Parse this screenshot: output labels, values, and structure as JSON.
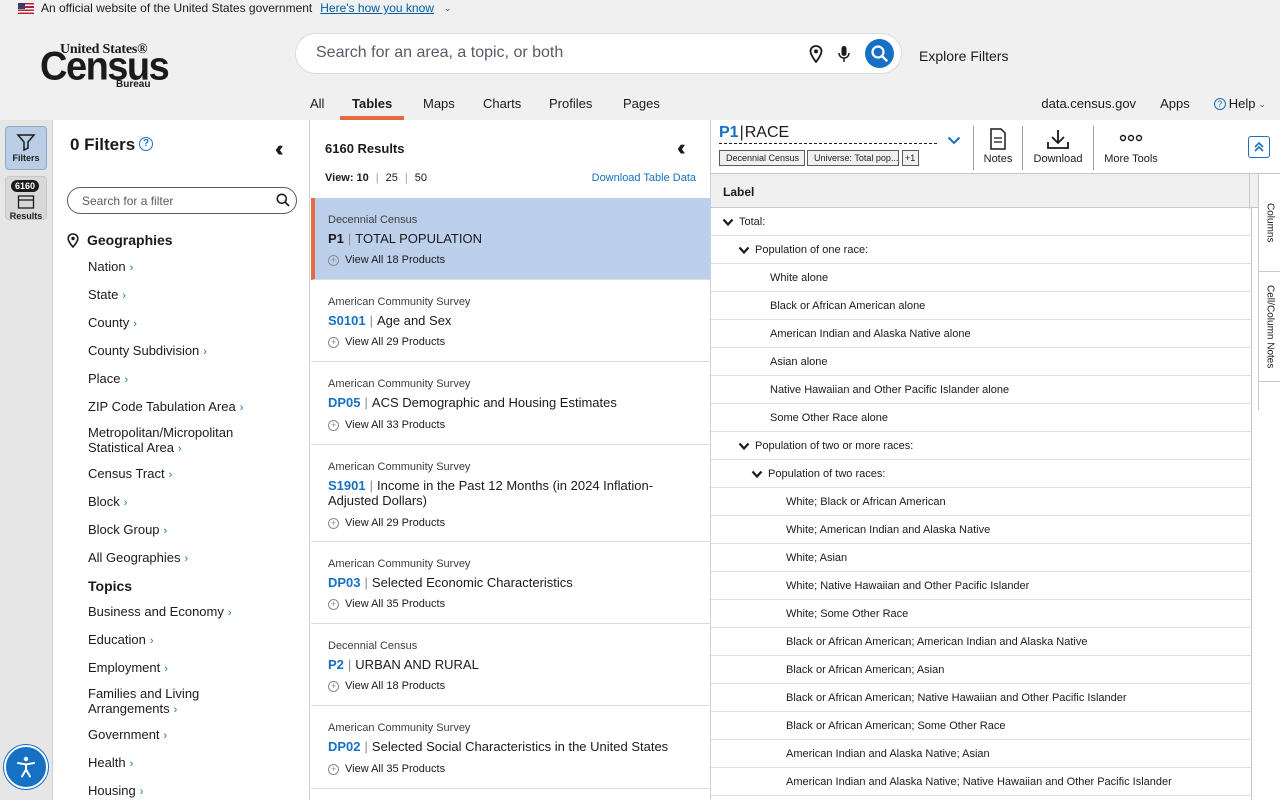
{
  "gov_banner": {
    "text": "An official website of the United States government",
    "link": "Here's how you know"
  },
  "logo": {
    "top": "United States®",
    "main": "Census",
    "bureau": "Bureau"
  },
  "search": {
    "placeholder": "Search for an area, a topic, or both",
    "explore": "Explore Filters"
  },
  "nav": {
    "tabs": [
      "All",
      "Tables",
      "Maps",
      "Charts",
      "Profiles",
      "Pages"
    ],
    "active": "Tables",
    "right": [
      "data.census.gov",
      "Apps",
      "Help"
    ]
  },
  "rail": {
    "filters_label": "Filters",
    "results_label": "Results",
    "results_count": "6160"
  },
  "filters": {
    "title": "0 Filters",
    "search_placeholder": "Search for a filter",
    "geographies_head": "Geographies",
    "geographies": [
      "Nation",
      "State",
      "County",
      "County Subdivision",
      "Place",
      "ZIP Code Tabulation Area",
      [
        "Metropolitan/Micropolitan",
        "Statistical Area"
      ],
      "Census Tract",
      "Block",
      "Block Group",
      "All Geographies"
    ],
    "topics_head": "Topics",
    "topics": [
      "Business and Economy",
      "Education",
      "Employment",
      [
        "Families and Living",
        "Arrangements"
      ],
      "Government",
      "Health",
      "Housing"
    ]
  },
  "results": {
    "count": "6160 Results",
    "view_label": "View:",
    "view_options": [
      "10",
      "25",
      "50"
    ],
    "download": "Download Table Data",
    "items": [
      {
        "source": "Decennial Census",
        "code": "P1",
        "title": "TOTAL POPULATION",
        "products": "View All 18 Products"
      },
      {
        "source": "American Community Survey",
        "code": "S0101",
        "title": "Age and Sex",
        "products": "View All 29 Products"
      },
      {
        "source": "American Community Survey",
        "code": "DP05",
        "title": "ACS Demographic and Housing Estimates",
        "products": "View All 33 Products"
      },
      {
        "source": "American Community Survey",
        "code": "S1901",
        "title": "Income in the Past 12 Months (in 2024 Inflation-Adjusted Dollars)",
        "products": "View All 29 Products"
      },
      {
        "source": "American Community Survey",
        "code": "DP03",
        "title": "Selected Economic Characteristics",
        "products": "View All 35 Products"
      },
      {
        "source": "Decennial Census",
        "code": "P2",
        "title": "URBAN AND RURAL",
        "products": "View All 18 Products"
      },
      {
        "source": "American Community Survey",
        "code": "DP02",
        "title": "Selected Social Characteristics in the United States",
        "products": "View All 35 Products"
      }
    ]
  },
  "table": {
    "code": "P1",
    "title": "RACE",
    "chips": [
      "Decennial Census",
      "Universe: Total pop...",
      "+1"
    ],
    "tools": [
      "Notes",
      "Download",
      "More Tools"
    ],
    "header_label": "Label",
    "side_tabs": [
      "Columns",
      "Cell/Column Notes"
    ],
    "rows": [
      {
        "text": "Total:",
        "level": 0,
        "expand": true
      },
      {
        "text": "Population of one race:",
        "level": 1,
        "expand": true
      },
      {
        "text": "White alone",
        "level": 2,
        "expand": false
      },
      {
        "text": "Black or African American alone",
        "level": 2,
        "expand": false
      },
      {
        "text": "American Indian and Alaska Native alone",
        "level": 2,
        "expand": false
      },
      {
        "text": "Asian alone",
        "level": 2,
        "expand": false
      },
      {
        "text": "Native Hawaiian and Other Pacific Islander alone",
        "level": 2,
        "expand": false
      },
      {
        "text": "Some Other Race alone",
        "level": 2,
        "expand": false
      },
      {
        "text": "Population of two or more races:",
        "level": 1,
        "expand": true
      },
      {
        "text": "Population of two races:",
        "level": 2,
        "expand": true
      },
      {
        "text": "White; Black or African American",
        "level": 3,
        "expand": false
      },
      {
        "text": "White; American Indian and Alaska Native",
        "level": 3,
        "expand": false
      },
      {
        "text": "White; Asian",
        "level": 3,
        "expand": false
      },
      {
        "text": "White; Native Hawaiian and Other Pacific Islander",
        "level": 3,
        "expand": false
      },
      {
        "text": "White; Some Other Race",
        "level": 3,
        "expand": false
      },
      {
        "text": "Black or African American; American Indian and Alaska Native",
        "level": 3,
        "expand": false
      },
      {
        "text": "Black or African American; Asian",
        "level": 3,
        "expand": false
      },
      {
        "text": "Black or African American; Native Hawaiian and Other Pacific Islander",
        "level": 3,
        "expand": false
      },
      {
        "text": "Black or African American; Some Other Race",
        "level": 3,
        "expand": false
      },
      {
        "text": "American Indian and Alaska Native; Asian",
        "level": 3,
        "expand": false
      },
      {
        "text": "American Indian and Alaska Native; Native Hawaiian and Other Pacific Islander",
        "level": 3,
        "expand": false
      }
    ]
  },
  "colors": {
    "accent": "#1670c3",
    "active_tab": "#e46b45",
    "selected_row": "#bcd0eb"
  }
}
